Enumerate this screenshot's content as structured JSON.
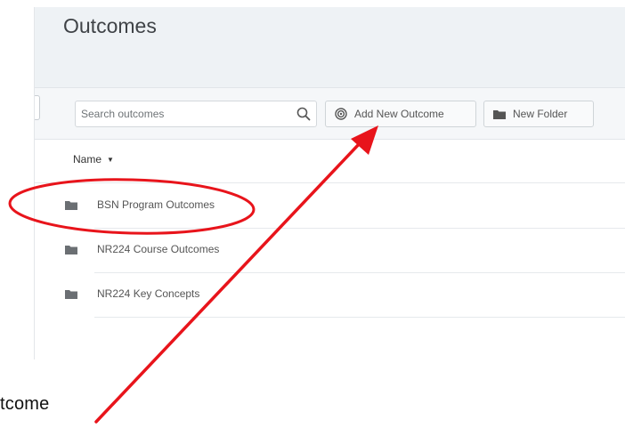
{
  "header": {
    "title": "Outcomes"
  },
  "toolbar": {
    "search_placeholder": "Search outcomes",
    "add_new_outcome_label": "Add New Outcome",
    "new_folder_label": "New Folder"
  },
  "list": {
    "name_column_label": "Name",
    "rows": [
      {
        "label": "BSN Program Outcomes"
      },
      {
        "label": "NR224 Course Outcomes"
      },
      {
        "label": "NR224 Key Concepts"
      }
    ]
  },
  "caption": {
    "text": "tcome"
  },
  "colors": {
    "annotation_red": "#e8141b",
    "header_bg": "#eef2f5",
    "icon_gray": "#6b6f73"
  }
}
